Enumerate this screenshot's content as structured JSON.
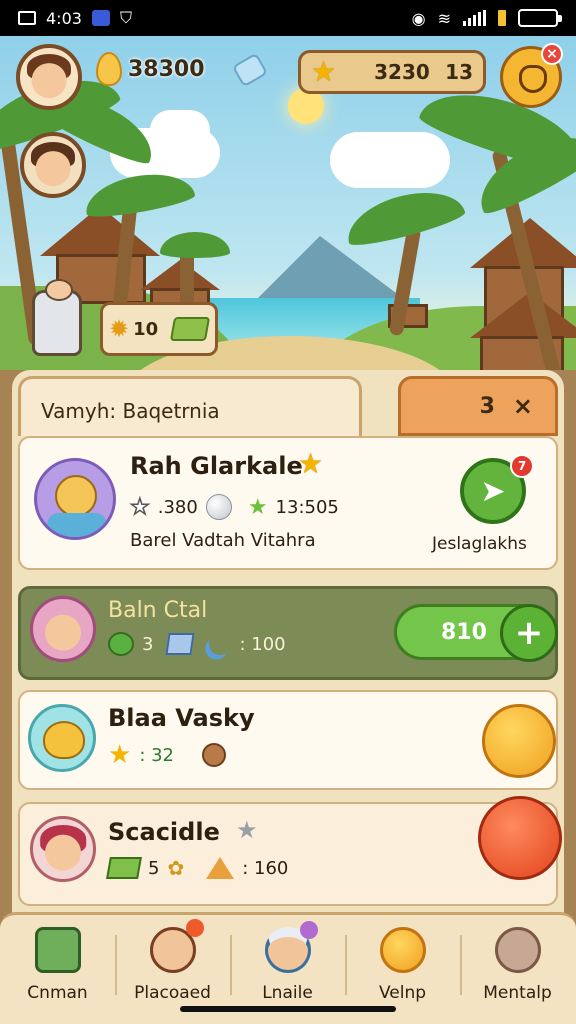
{
  "status_bar": {
    "time": "4:03",
    "icons": [
      "screen-icon",
      "app-icon",
      "shield-icon",
      "alarm-icon",
      "wifi-icon",
      "signal-icon",
      "battery-icon"
    ]
  },
  "hud": {
    "coins": "38300",
    "stars_value": "3230",
    "stars_count": "13",
    "profile_badge": "×",
    "quest_chip_value": "10"
  },
  "panel": {
    "title": "Vamyh: Baqetrnia",
    "count": "3",
    "close": "×"
  },
  "cards": [
    {
      "title": "Rah Glarkale",
      "stat1": ".380",
      "stat2": "13:505",
      "subtitle": "Barel Vadtah Vitahra",
      "action_label": "Jeslaglakhs",
      "action_badge": "7"
    },
    {
      "title": "Baln Ctal",
      "stat1": "3",
      "stat2": ": 100",
      "buy_value": "810",
      "buy_plus": "+"
    },
    {
      "title": "Blaa Vasky",
      "stat1": ": 32"
    },
    {
      "title": "Scacidle",
      "stat1": "5",
      "stat2": ": 160"
    }
  ],
  "nav": [
    {
      "label": "Cnman",
      "icon": "calculator-icon"
    },
    {
      "label": "Placoaed",
      "icon": "villager-icon"
    },
    {
      "label": "Lnaile",
      "icon": "chef-icon"
    },
    {
      "label": "Velnp",
      "icon": "sun-face-icon"
    },
    {
      "label": "Mentalp",
      "icon": "mouse-icon"
    }
  ],
  "colors": {
    "accent_green": "#63b43c",
    "accent_orange": "#eda35b",
    "panel_bg": "#f0e1bf",
    "badge_red": "#e23a2e",
    "gold": "#f4b400"
  }
}
